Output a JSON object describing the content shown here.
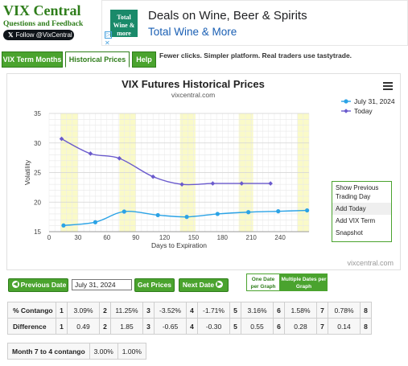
{
  "brand": {
    "title": "VIX Central",
    "subtitle": "Questions and Feedback",
    "follow_label": "Follow @VixCentral"
  },
  "ad": {
    "logo_text": "Total Wine & more",
    "headline": "Deals on Wine, Beer & Spirits",
    "subline": "Total Wine & More"
  },
  "tabs": [
    {
      "label": "VIX Term Months"
    },
    {
      "label": "Historical Prices"
    },
    {
      "label": "Help"
    }
  ],
  "promo": "Fewer clicks. Simpler platform. Real traders use tastytrade.",
  "chart": {
    "title": "VIX Futures Historical Prices",
    "subtitle": "vixcentral.com",
    "watermark": "vixcentral.com",
    "menu_icon": "hamburger-icon"
  },
  "chart_data": {
    "type": "line",
    "title": "VIX Futures Historical Prices",
    "xlabel": "Days to Expiration",
    "ylabel": "Volatility",
    "xlim": [
      0,
      270
    ],
    "ylim": [
      15,
      35
    ],
    "x_ticks": [
      0,
      30,
      60,
      90,
      120,
      150,
      180,
      210,
      240
    ],
    "y_ticks": [
      15,
      20,
      25,
      30,
      35
    ],
    "grid": true,
    "legend_position": "top-right",
    "series": [
      {
        "name": "July 31, 2024",
        "color": "#2ba3e6",
        "x": [
          15,
          48,
          78,
          113,
          143,
          175,
          207,
          238,
          268
        ],
        "y": [
          16.05,
          16.6,
          18.4,
          17.8,
          17.5,
          18.0,
          18.3,
          18.45,
          18.6
        ]
      },
      {
        "name": "Today",
        "color": "#6a5acd",
        "x": [
          13,
          43,
          73,
          108,
          138,
          170,
          200,
          230
        ],
        "y": [
          30.7,
          28.2,
          27.4,
          24.3,
          23.0,
          23.15,
          23.15,
          23.15
        ]
      }
    ],
    "shaded_bands": [
      [
        12,
        30
      ],
      [
        73,
        90
      ],
      [
        136,
        152
      ],
      [
        197,
        212
      ],
      [
        258,
        270
      ]
    ]
  },
  "context_menu": {
    "items": [
      "Show Previous Trading Day",
      "Add Today",
      "Add VIX Term",
      "Snapshot"
    ]
  },
  "controls": {
    "prev_label": "Previous Date",
    "date_value": "July 31, 2024",
    "get_prices_label": "Get Prices",
    "next_label": "Next Date",
    "one_date_label": "One Date per Graph",
    "multi_date_label": "Multiple Dates per Graph"
  },
  "contango_table": {
    "rows": [
      {
        "label": "% Contango",
        "cells": [
          [
            "1",
            "3.09%"
          ],
          [
            "2",
            "11.25%"
          ],
          [
            "3",
            "-3.52%"
          ],
          [
            "4",
            "-1.71%"
          ],
          [
            "5",
            "3.16%"
          ],
          [
            "6",
            "1.58%"
          ],
          [
            "7",
            "0.78%"
          ],
          [
            "8",
            ""
          ]
        ]
      },
      {
        "label": "Difference",
        "cells": [
          [
            "1",
            "0.49"
          ],
          [
            "2",
            "1.85"
          ],
          [
            "3",
            "-0.65"
          ],
          [
            "4",
            "-0.30"
          ],
          [
            "5",
            "0.55"
          ],
          [
            "6",
            "0.28"
          ],
          [
            "7",
            "0.14"
          ],
          [
            "8",
            ""
          ]
        ]
      }
    ]
  },
  "month_table": {
    "label": "Month 7 to 4 contango",
    "v1": "3.00%",
    "v2": "1.00%"
  }
}
